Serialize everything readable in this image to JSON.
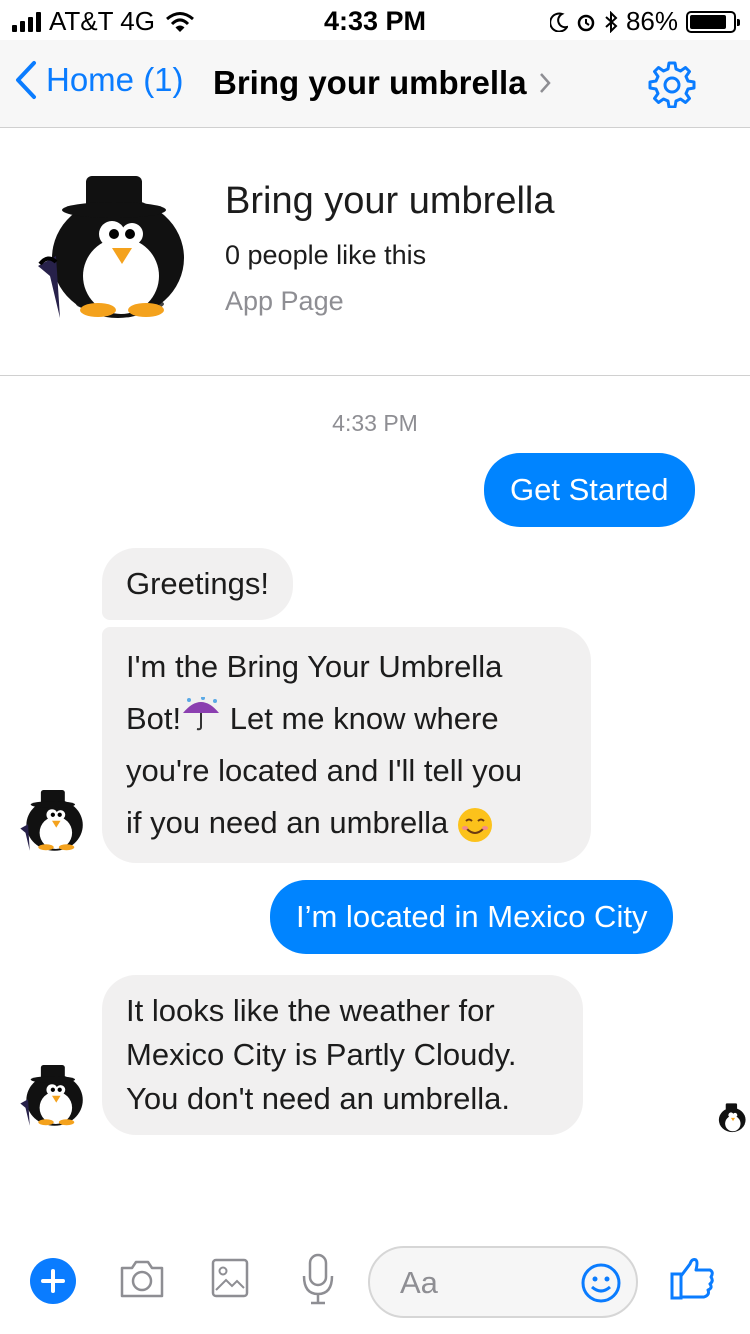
{
  "status_bar": {
    "carrier": "AT&T 4G",
    "time": "4:33 PM",
    "battery": "86%",
    "battery_level": 0.86
  },
  "nav": {
    "back_label": "Home (1)",
    "title": "Bring your umbrella"
  },
  "page_header": {
    "name": "Bring your umbrella",
    "likes": "0 people like this",
    "type": "App Page"
  },
  "conversation": {
    "timestamp": "4:33 PM",
    "messages": [
      {
        "from": "user",
        "text": "Get Started"
      },
      {
        "from": "bot",
        "text": "Greetings!"
      },
      {
        "from": "bot",
        "line1": "I'm the Bring Your Umbrella",
        "line2a": "Bot!",
        "line2b": " Let me know where",
        "line3": "you're located and I'll tell you",
        "line4": "if you need an umbrella "
      },
      {
        "from": "user",
        "text": "I’m located in Mexico City"
      },
      {
        "from": "bot",
        "line1": "It looks like the weather for",
        "line2": "Mexico City is Partly Cloudy.",
        "line3": "You don't need an umbrella."
      }
    ]
  },
  "composer": {
    "placeholder": "Aa"
  },
  "colors": {
    "accent": "#0a7cff",
    "outgoing_bubble": "#0084ff",
    "incoming_bubble": "#f1f0f0"
  },
  "icons": [
    "signal-bars-icon",
    "wifi-icon",
    "moon-icon",
    "alarm-icon",
    "bluetooth-icon",
    "battery-icon",
    "back-chevron-icon",
    "chevron-right-icon",
    "gear-icon",
    "penguin-avatar",
    "umbrella-rain-emoji",
    "smiling-emoji",
    "plus-icon",
    "camera-icon",
    "gallery-icon",
    "microphone-icon",
    "emoji-icon",
    "thumbs-up-icon"
  ]
}
